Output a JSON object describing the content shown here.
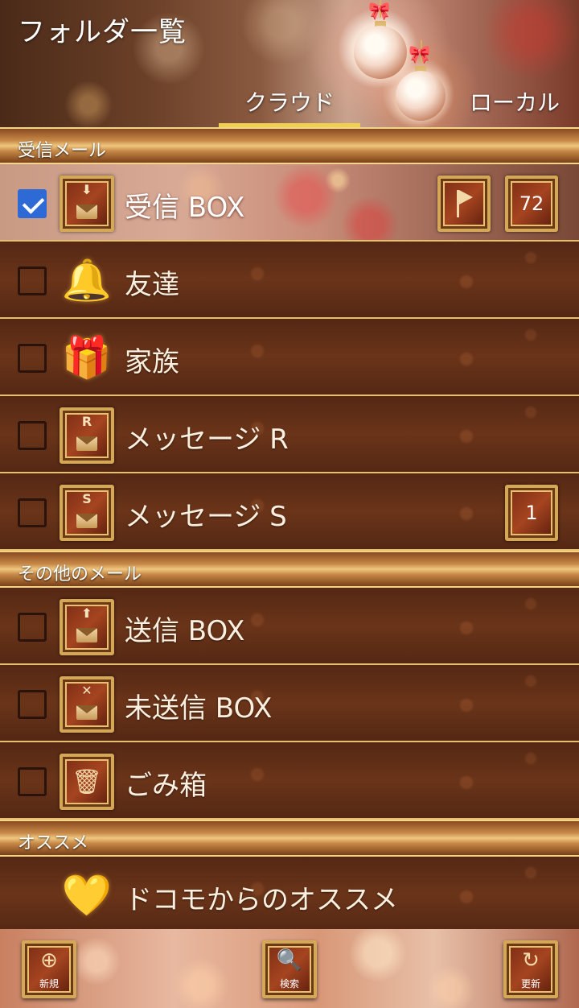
{
  "header": {
    "title": "フォルダ一覧",
    "tabs": [
      {
        "label": "クラウド",
        "active": true
      },
      {
        "label": "ローカル",
        "active": false
      }
    ]
  },
  "sections": [
    {
      "title": "受信メール",
      "rows": [
        {
          "label": "受信 BOX",
          "checked": true,
          "icon": "inbox-download-icon",
          "flag_badge": true,
          "count": "72"
        },
        {
          "label": "友達",
          "checked": false,
          "icon": "bell-icon"
        },
        {
          "label": "家族",
          "checked": false,
          "icon": "gift-box-icon"
        },
        {
          "label": "メッセージ R",
          "checked": false,
          "icon": "message-r-icon",
          "icon_letter": "R"
        },
        {
          "label": "メッセージ S",
          "checked": false,
          "icon": "message-s-icon",
          "icon_letter": "S",
          "count": "1"
        }
      ]
    },
    {
      "title": "その他のメール",
      "rows": [
        {
          "label": "送信 BOX",
          "checked": false,
          "icon": "outbox-upload-icon"
        },
        {
          "label": "未送信 BOX",
          "checked": false,
          "icon": "unsent-envelope-icon"
        },
        {
          "label": "ごみ箱",
          "checked": false,
          "icon": "trash-icon"
        }
      ]
    },
    {
      "title": "オススメ",
      "rows": [
        {
          "label": "ドコモからのオススメ",
          "icon": "heart-ornament-icon"
        }
      ]
    }
  ],
  "bottom_bar": {
    "new_label": "新規",
    "search_label": "検索",
    "refresh_label": "更新"
  },
  "colors": {
    "accent": "#f0d050",
    "checkbox_checked": "#2e6ad6",
    "gold_frame": "#d4a858",
    "row_bg": "#5e2c16"
  }
}
